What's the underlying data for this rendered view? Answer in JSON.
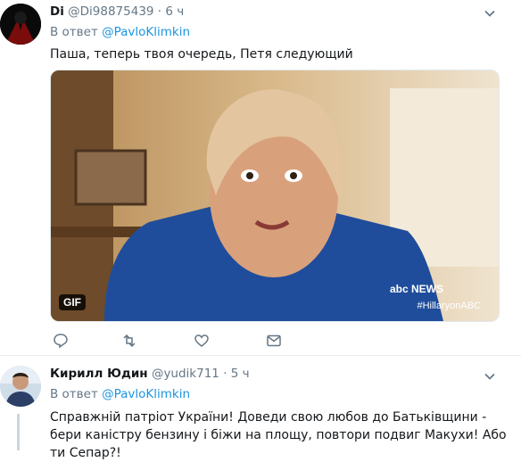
{
  "tweets": [
    {
      "name": "Di",
      "handle": "@Di98875439",
      "dot": "·",
      "time": "6 ч",
      "reply_prefix": "В ответ",
      "reply_user": "@PavloKlimkin",
      "text": "Паша, теперь твоя очередь, Петя следующий",
      "media": {
        "badge": "GIF",
        "logo": "abc NEWS",
        "hashtag": "#HillaryonABC"
      },
      "actions": [
        "reply-icon",
        "retweet-icon",
        "like-icon",
        "message-icon"
      ]
    },
    {
      "name": "Кирилл Юдин",
      "handle": "@yudik711",
      "dot": "·",
      "time": "5 ч",
      "reply_prefix": "В ответ",
      "reply_user": "@PavloKlimkin",
      "text": "Справжній патріот України! Доведи свою любов до Батьківщини - бери каністру бензину і біжи на площу, повтори подвиг Макухи! Або ти Сепар?!"
    }
  ],
  "colors": {
    "link": "#1b95e0",
    "muted": "#657786",
    "divider": "#e6ecf0"
  }
}
